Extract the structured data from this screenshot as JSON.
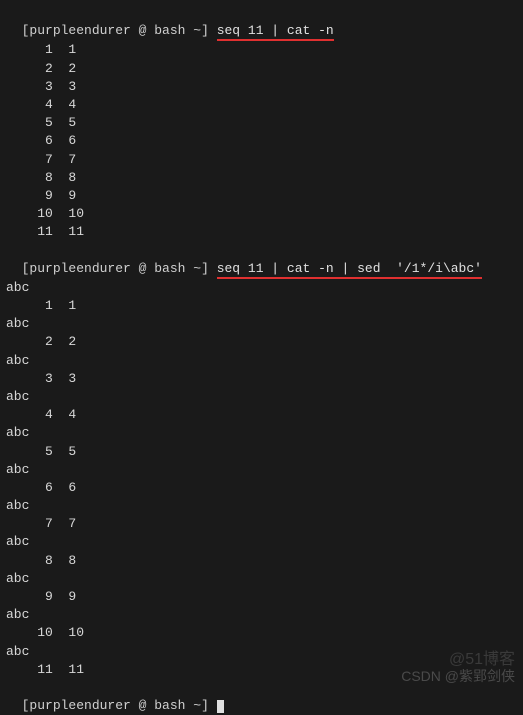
{
  "prompt1": {
    "bracket_open": "[",
    "user": "purpleendurer",
    "at": " @ ",
    "host": "bash",
    "path": " ~",
    "bracket_close": "]",
    "command": "seq 11 | cat -n"
  },
  "output1": [
    "     1  1",
    "     2  2",
    "     3  3",
    "     4  4",
    "     5  5",
    "     6  6",
    "     7  7",
    "     8  8",
    "     9  9",
    "    10  10",
    "    11  11"
  ],
  "prompt2": {
    "bracket_open": "[",
    "user": "purpleendurer",
    "at": " @ ",
    "host": "bash",
    "path": " ~",
    "bracket_close": "]",
    "command": "seq 11 | cat -n | sed  '/1*/i\\abc'"
  },
  "output2": [
    "abc",
    "     1  1",
    "abc",
    "     2  2",
    "abc",
    "     3  3",
    "abc",
    "     4  4",
    "abc",
    "     5  5",
    "abc",
    "     6  6",
    "abc",
    "     7  7",
    "abc",
    "     8  8",
    "abc",
    "     9  9",
    "abc",
    "    10  10",
    "abc",
    "    11  11"
  ],
  "prompt3": {
    "bracket_open": "[",
    "user": "purpleendurer",
    "at": " @ ",
    "host": "bash",
    "path": " ~",
    "bracket_close": "]"
  },
  "watermark1": "@51博客",
  "watermark2": "CSDN @紫郢剑侠"
}
